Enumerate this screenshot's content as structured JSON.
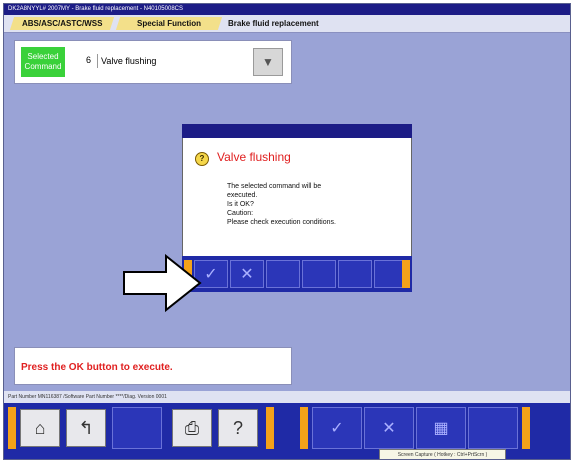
{
  "window": {
    "title": "DK2A8NYYL# 2007MY  -  Brake fluid replacement  -  N40105008CS"
  },
  "tabs": [
    {
      "label": "ABS/ASC/ASTC/WSS"
    },
    {
      "label": "Special Function"
    },
    {
      "label": "Brake fluid replacement"
    }
  ],
  "command": {
    "label": "Selected Command",
    "number": "6",
    "name": "Valve flushing",
    "dropdown_icon": "triangle-down-icon"
  },
  "dialog": {
    "icon": "question-icon",
    "icon_glyph": "?",
    "title": "Valve flushing",
    "message": "The selected command will be\nexecuted.\nIs it OK?\nCaution:\nPlease check execution conditions.",
    "ok_glyph": "✓",
    "cancel_glyph": "✕"
  },
  "prompt": {
    "text": "Press the OK button to execute."
  },
  "status": {
    "text": "Part Number MN116387  /Software Part Number ****/Diag. Version 0001"
  },
  "toolbar": {
    "home_glyph": "⌂",
    "back_glyph": "↰",
    "print_glyph": "⎙",
    "help_glyph": "?",
    "ok_glyph": "✓",
    "cancel_glyph": "✕",
    "screen_glyph": "▦"
  },
  "tooltip": {
    "text": "Screen Capture ( Hotkey : Ctrl+PrtScrn )"
  },
  "colors": {
    "accent": "#1f2aa6",
    "frame": "#9aa3d6",
    "alert": "#e02020",
    "edge": "#f3a21a",
    "selected": "#3ad13a"
  }
}
